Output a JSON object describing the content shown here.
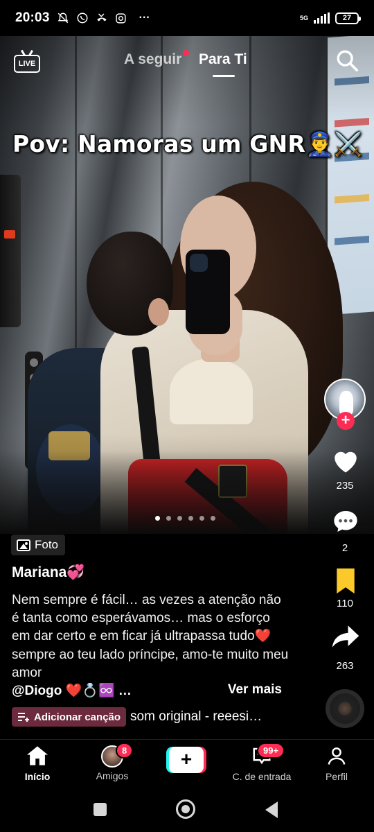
{
  "status_bar": {
    "time": "20:03",
    "network": "5G",
    "battery": "27",
    "more": "···"
  },
  "top_nav": {
    "live_label": "LIVE",
    "tab_following": "A seguir",
    "tab_for_you": "Para Ti",
    "active_tab": "Para Ti"
  },
  "post": {
    "overlay_caption": "Pov: Namoras um GNR👮‍♂️⚔️",
    "type_badge": "Foto",
    "username": "Mariana💞",
    "description": "Nem sempre é fácil… as vezes a atenção não é tanta como esperávamos… mas o esforço em dar certo e em ficar já ultrapassa tudo❤️ sempre ao teu lado príncipe, amo-te muito meu amor",
    "mention_line": "@Diogo ❤️💍♾️ …",
    "see_more": "Ver mais",
    "add_song": "Adicionar canção",
    "sound": "som original - reeesi…",
    "carousel": {
      "total": 6,
      "active_index": 0
    }
  },
  "actions": {
    "likes": "235",
    "comments": "2",
    "saves": "110",
    "shares": "263",
    "follow_symbol": "+"
  },
  "tab_bar": {
    "home": "Início",
    "friends": "Amigos",
    "friends_badge": "8",
    "create_symbol": "+",
    "inbox": "C. de entrada",
    "inbox_badge": "99+",
    "profile": "Perfil"
  },
  "colors": {
    "accent_red": "#fe2c55",
    "accent_cyan": "#25f4ee",
    "save_yellow": "#fbc92a",
    "add_song_bg": "#6b2a3e"
  }
}
